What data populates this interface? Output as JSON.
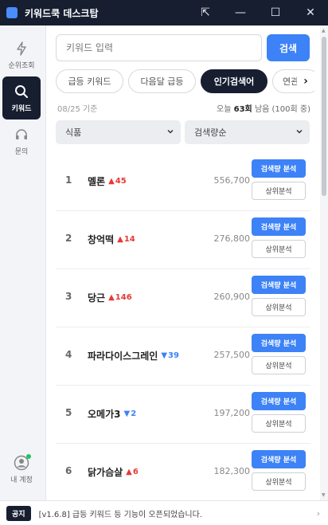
{
  "app": {
    "title": "키워드쿡 데스크탑"
  },
  "window_controls": {
    "pin": "⇱",
    "minimize": "—",
    "maximize": "☐",
    "close": "✕"
  },
  "sidebar": {
    "items": [
      {
        "label": "순위조회",
        "icon": "lightning-icon",
        "active": false
      },
      {
        "label": "키워드",
        "icon": "search-icon",
        "active": true
      },
      {
        "label": "문의",
        "icon": "headset-icon",
        "active": false
      }
    ],
    "account": {
      "label": "내 계정",
      "icon": "user-icon",
      "status_color": "#22c55e"
    }
  },
  "search": {
    "placeholder": "키워드 입력",
    "value": "",
    "button_label": "검색"
  },
  "tabs": [
    {
      "label": "급등 키워드",
      "active": false
    },
    {
      "label": "다음달 급등",
      "active": false
    },
    {
      "label": "인기검색어",
      "active": true
    },
    {
      "label": "연관",
      "active": false
    }
  ],
  "tabs_next_icon": "›",
  "meta": {
    "date": "08/25 기준",
    "today_prefix": "오늘",
    "today_count": "63회",
    "remaining": "남음 (100회 중)"
  },
  "filters": {
    "category": "식품",
    "sort": "검색량순"
  },
  "buttons": {
    "analyze": "검색량 분석",
    "top": "상위분석"
  },
  "rows": [
    {
      "rank": "1",
      "keyword": "멜론",
      "direction": "up",
      "change": "45",
      "volume": "556,700"
    },
    {
      "rank": "2",
      "keyword": "창억떡",
      "direction": "up",
      "change": "14",
      "volume": "276,800"
    },
    {
      "rank": "3",
      "keyword": "당근",
      "direction": "up",
      "change": "146",
      "volume": "260,900"
    },
    {
      "rank": "4",
      "keyword": "파라다이스그레인",
      "direction": "down",
      "change": "39",
      "volume": "257,500"
    },
    {
      "rank": "5",
      "keyword": "오메가3",
      "direction": "down",
      "change": "2",
      "volume": "197,200"
    },
    {
      "rank": "6",
      "keyword": "닭가슴살",
      "direction": "up",
      "change": "6",
      "volume": "182,300"
    }
  ],
  "footer": {
    "badge": "공지",
    "text": "[v1.6.8] 급등 키워드 등 기능이 오픈되었습니다.",
    "arrow": "›"
  },
  "colors": {
    "accent": "#3d82f6",
    "dark": "#161e30",
    "up": "#e53935",
    "down": "#3d82f6"
  }
}
